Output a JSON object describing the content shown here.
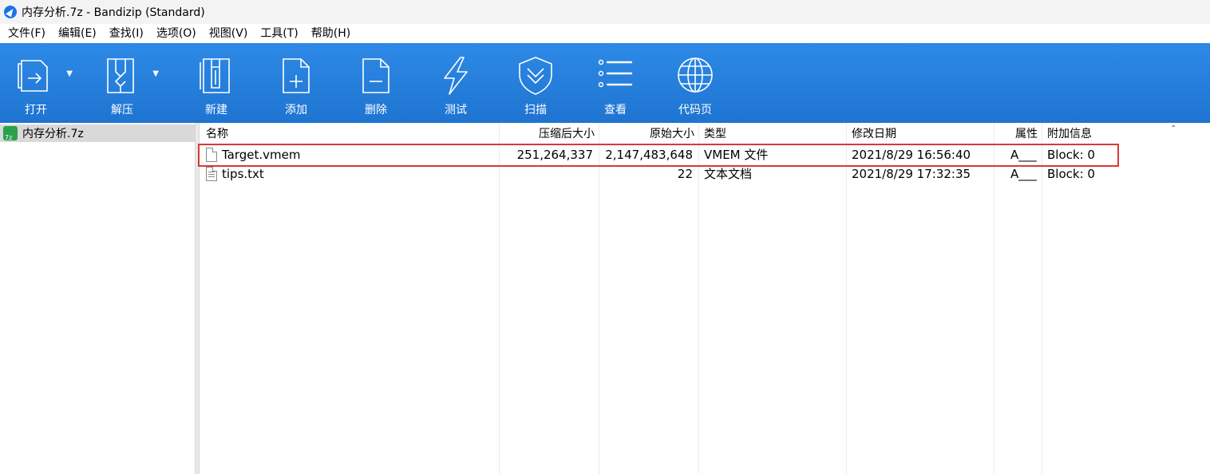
{
  "window": {
    "title": "内存分析.7z - Bandizip (Standard)"
  },
  "menu": [
    "文件(F)",
    "编辑(E)",
    "查找(I)",
    "选项(O)",
    "视图(V)",
    "工具(T)",
    "帮助(H)"
  ],
  "toolbar": {
    "open": "打开",
    "extract": "解压",
    "new": "新建",
    "add": "添加",
    "delete": "删除",
    "test": "测试",
    "scan": "扫描",
    "view": "查看",
    "codepage": "代码页"
  },
  "tree": {
    "archive": "内存分析.7z"
  },
  "columns": {
    "name": "名称",
    "compressed": "压缩后大小",
    "original": "原始大小",
    "type": "类型",
    "modified": "修改日期",
    "attr": "属性",
    "info": "附加信息"
  },
  "files": [
    {
      "name": "Target.vmem",
      "compressed": "251,264,337",
      "original": "2,147,483,648",
      "type": "VMEM 文件",
      "modified": "2021/8/29 16:56:40",
      "attr": "A___",
      "info": "Block: 0"
    },
    {
      "name": "tips.txt",
      "compressed": "",
      "original": "22",
      "type": "文本文档",
      "modified": "2021/8/29 17:32:35",
      "attr": "A___",
      "info": "Block: 0"
    }
  ],
  "colors": {
    "toolbar": "#2a85e2",
    "highlight": "#d93838",
    "tree_selected": "#d9d9d9"
  }
}
